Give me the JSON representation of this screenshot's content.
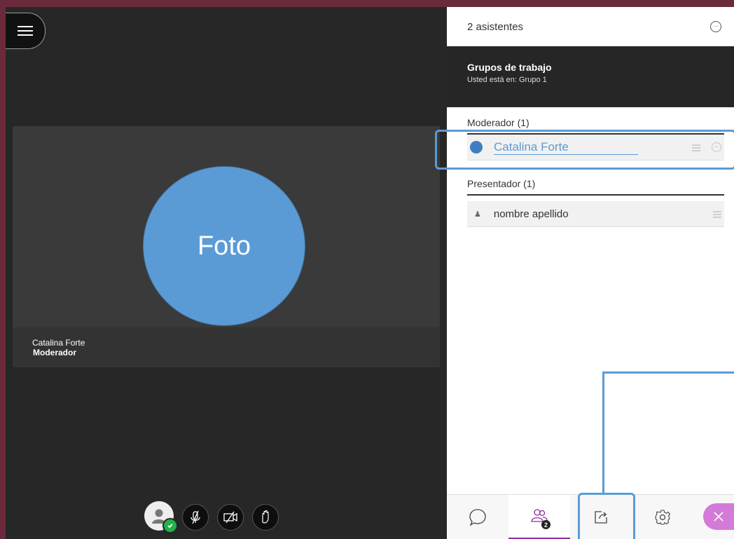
{
  "stage": {
    "menu_icon": "hamburger-menu-icon",
    "tile": {
      "photo_label": "Foto",
      "name": "Catalina Forte",
      "role": "Moderador"
    },
    "controls": [
      {
        "icon": "user-avatar-icon",
        "status": "check-icon"
      },
      {
        "icon": "microphone-off-icon"
      },
      {
        "icon": "camera-off-icon"
      },
      {
        "icon": "raise-hand-icon"
      }
    ]
  },
  "panel": {
    "attendee_count": "2 asistentes",
    "groups_title": "Grupos de trabajo",
    "groups_subtitle": "Usted está en: Grupo 1",
    "moderator_section": "Moderador (1)",
    "moderator_name": "Catalina Forte",
    "presenter_section": "Presentador (1)",
    "presenter_name": "nombre apellido",
    "tabs": [
      {
        "name": "chat",
        "icon": "chat-bubble-icon"
      },
      {
        "name": "attendees",
        "icon": "attendees-icon",
        "badge": "2"
      },
      {
        "name": "share",
        "icon": "share-content-icon"
      },
      {
        "name": "settings",
        "icon": "gear-icon"
      },
      {
        "name": "close",
        "icon": "close-icon"
      }
    ]
  },
  "colors": {
    "accent_purple": "#8e2d9e",
    "highlight_blue": "#5b9bd5",
    "photo_circle": "#5b9bd5",
    "background_frame": "#6b2a3c"
  }
}
